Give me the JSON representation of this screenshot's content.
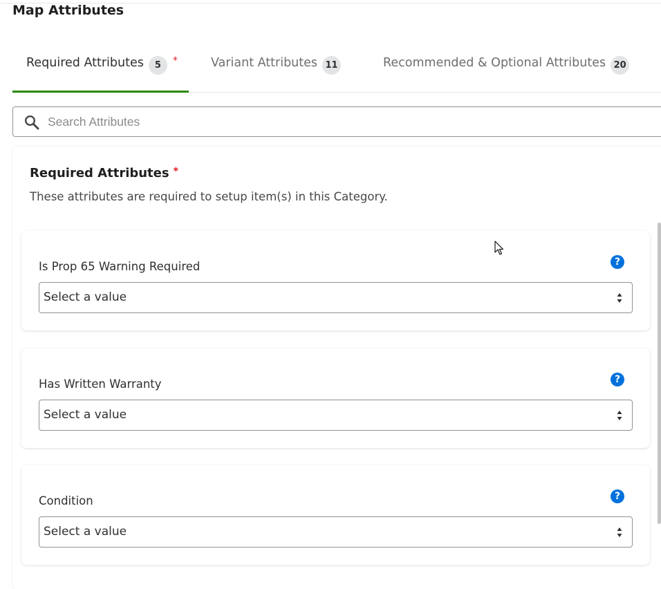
{
  "page": {
    "title": "Map Attributes"
  },
  "tabs": [
    {
      "label": "Required Attributes",
      "count": "5",
      "required_mark": "*",
      "active": true
    },
    {
      "label": "Variant Attributes",
      "count": "11",
      "active": false
    },
    {
      "label": "Recommended & Optional Attributes",
      "count": "20",
      "active": false
    }
  ],
  "search": {
    "placeholder": "Search Attributes",
    "value": "",
    "icon": "search-icon"
  },
  "section": {
    "title": "Required Attributes",
    "required_mark": "*",
    "description": "These attributes are required to setup item(s) in this Category."
  },
  "fields": [
    {
      "label": "Is Prop 65 Warning Required",
      "select_value": "Select a value",
      "help_icon": "?"
    },
    {
      "label": "Has Written Warranty",
      "select_value": "Select a value",
      "help_icon": "?"
    },
    {
      "label": "Condition",
      "select_value": "Select a value",
      "help_icon": "?"
    }
  ],
  "colors": {
    "accent_green": "#2a8703",
    "help_blue": "#0071dc",
    "required_red": "#de1c24",
    "badge_gray": "#e3e4e5"
  }
}
